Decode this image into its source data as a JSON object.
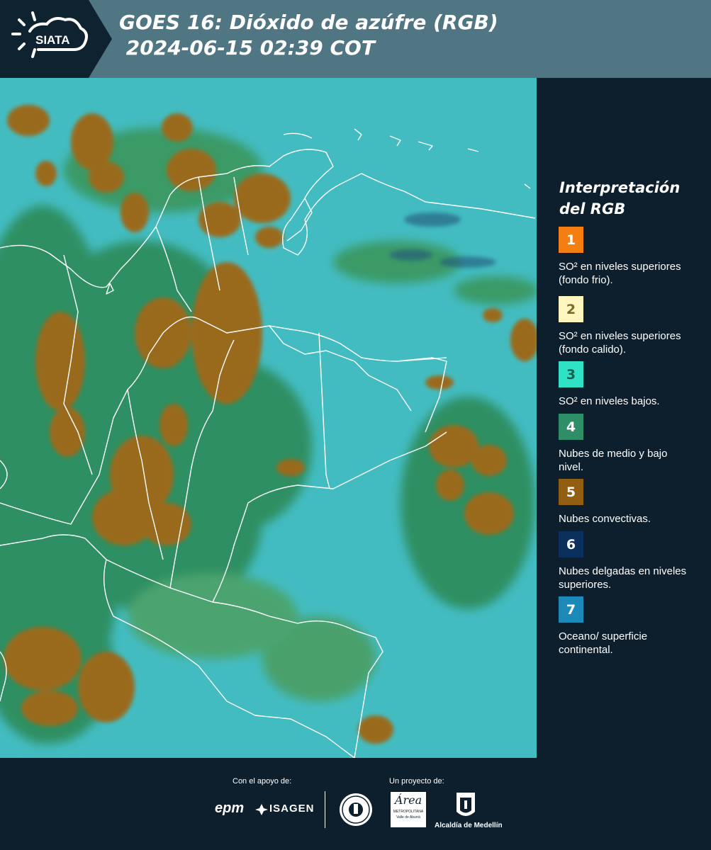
{
  "header": {
    "logo_text": "SIATA",
    "title": "GOES 16: Dióxido de azúfre (RGB)\n 2024-06-15 02:39 COT"
  },
  "map": {
    "base_color": "#3fb7bd",
    "border_color": "#ffffff"
  },
  "legend": {
    "title": "Interpretación del RGB",
    "items": [
      {
        "number": "1",
        "color": "#f57e13",
        "text_color": "#ffffff",
        "label": "SO² en niveles superiores (fondo frio)."
      },
      {
        "number": "2",
        "color": "#fff7bf",
        "text_color": "#7a6a2a",
        "label": "SO² en niveles superiores (fondo calido)."
      },
      {
        "number": "3",
        "color": "#2fe1c5",
        "text_color": "#1b5e55",
        "label": "SO² en niveles bajos."
      },
      {
        "number": "4",
        "color": "#2e8e67",
        "text_color": "#ffffff",
        "label": "Nubes de medio y bajo nivel."
      },
      {
        "number": "5",
        "color": "#925e11",
        "text_color": "#ffffff",
        "label": "Nubes convectivas."
      },
      {
        "number": "6",
        "color": "#0c305e",
        "text_color": "#ffffff",
        "label": "Nubes delgadas en niveles superiores."
      },
      {
        "number": "7",
        "color": "#1c8ab8",
        "text_color": "#ffffff",
        "label": "Oceano/ superficie continental."
      }
    ]
  },
  "footer": {
    "support_label": "Con el apoyo de:",
    "project_label": "Un proyecto de:",
    "sponsor_epm": "epm",
    "sponsor_isagen": "ISAGEN",
    "area_text": "Área",
    "area_sub": "METROPOLITANA",
    "area_sub2": "Valle de Aburrá",
    "alcaldia": "Alcaldía de Medellín"
  }
}
